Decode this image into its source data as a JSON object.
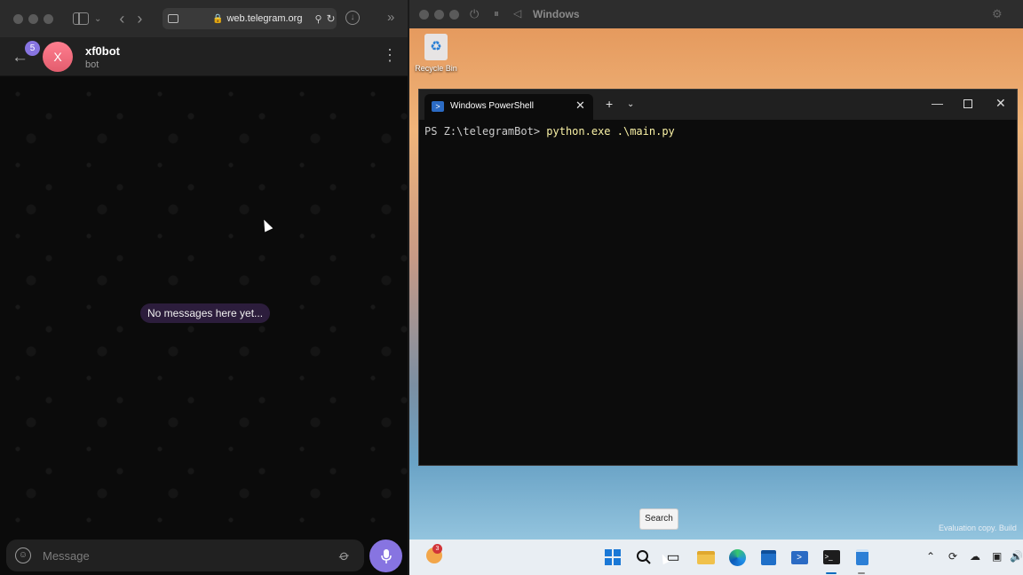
{
  "browser": {
    "url": "web.telegram.org",
    "lock_glyph": "🔒",
    "back_glyph": "‹",
    "forward_glyph": "›",
    "reload_glyph": "↻",
    "download_glyph": "↓",
    "more_glyph": "»",
    "translate_glyph": "⚲"
  },
  "telegram": {
    "unread_badge": "5",
    "chat_name": "xf0bot",
    "chat_status": "bot",
    "avatar_letter": "X",
    "back_glyph": "←",
    "menu_glyph": "⋮",
    "empty_text": "No messages here yet...",
    "composer_placeholder": "Message",
    "emoji_glyph": "☺",
    "attach_glyph": "📎",
    "mic_glyph": "🎤",
    "accent_color": "#8774e1"
  },
  "vm": {
    "window_name": "Windows",
    "power_glyph": "⏻",
    "pause_glyph": "⏸",
    "prev_glyph": "◁",
    "settings_glyph": "⚙"
  },
  "desktop": {
    "recycle_bin_label": "Recycle Bin",
    "recycle_glyph": "♻",
    "watermark": "Evaluation copy. Build"
  },
  "powershell": {
    "tab_title": "Windows PowerShell",
    "tab_icon_glyph": ">",
    "close_tab_glyph": "✕",
    "new_tab_glyph": "+",
    "dropdown_glyph": "⌄",
    "minimize_glyph": "—",
    "close_glyph": "✕",
    "prompt": "PS Z:\\telegramBot> ",
    "command": "python.exe .\\main.py"
  },
  "taskbar": {
    "search_tooltip": "Search",
    "weather_badge": "3",
    "search_glyph": "⌕",
    "taskview_glyph": "▭",
    "terminal_glyph": ">_",
    "tray_chevron": "⌃",
    "tray_sync": "⟳",
    "tray_cloud": "☁",
    "tray_network": "▣",
    "tray_volume": "🔊"
  }
}
